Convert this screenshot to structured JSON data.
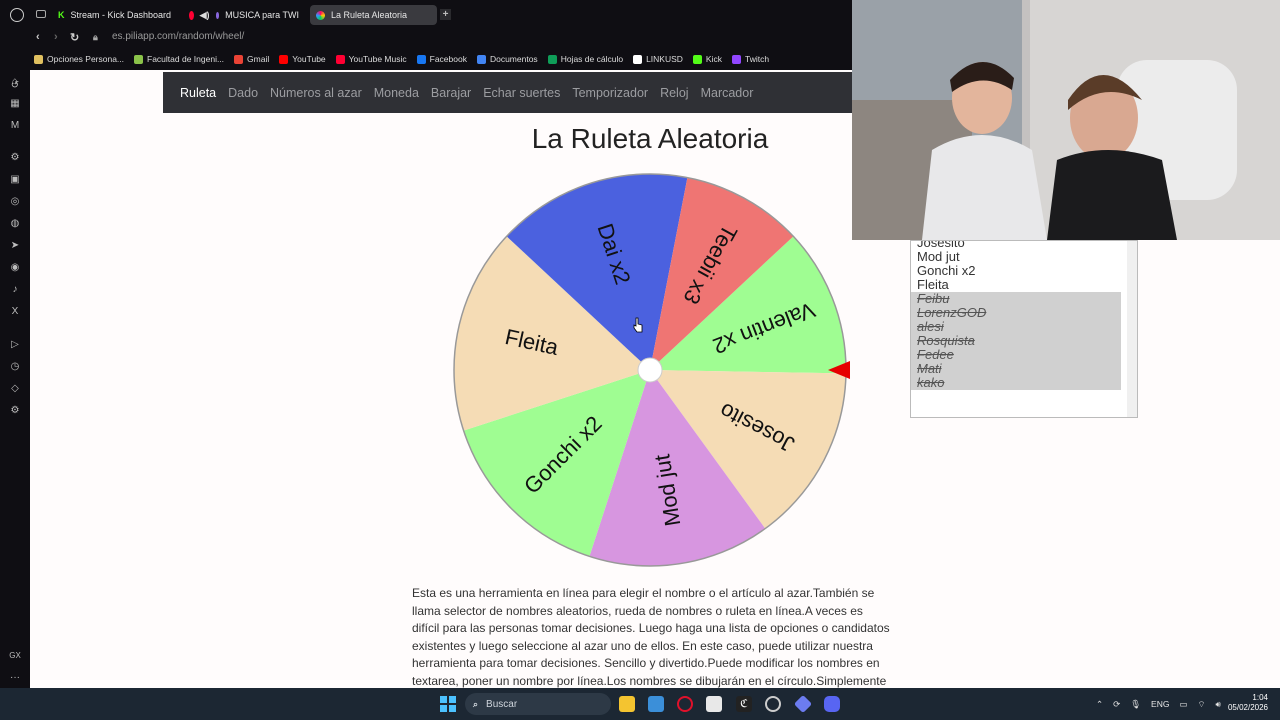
{
  "browser": {
    "tabs": [
      {
        "label": "Stream - Kick Dashboard",
        "icon": "kick-icon",
        "color": "#53fc18"
      },
      {
        "label": "MUSICA para TWI",
        "icon": "youtube-music-icon",
        "color": "#ff0033"
      },
      {
        "label": "La Ruleta Aleatoria",
        "icon": "piliapp-icon",
        "color": "#9c88ff"
      }
    ],
    "url": "es.piliapp.com/random/wheel/",
    "bookmarks": [
      {
        "label": "Opciones Persona...",
        "color": "#e0c060"
      },
      {
        "label": "Facultad de Ingeni...",
        "color": "#8bc34a"
      },
      {
        "label": "Gmail",
        "color": "#ea4335"
      },
      {
        "label": "YouTube",
        "color": "#ff0000"
      },
      {
        "label": "YouTube Music",
        "color": "#ff0033"
      },
      {
        "label": "Facebook",
        "color": "#1877f2"
      },
      {
        "label": "Documentos",
        "color": "#4285f4"
      },
      {
        "label": "Hojas de cálculo",
        "color": "#0f9d58"
      },
      {
        "label": "LINKUSD",
        "color": "#ffffff"
      },
      {
        "label": "Kick",
        "color": "#53fc18"
      },
      {
        "label": "Twitch",
        "color": "#9146ff"
      }
    ]
  },
  "nav": {
    "items": [
      "Ruleta",
      "Dado",
      "Números al azar",
      "Moneda",
      "Barajar",
      "Echar suertes",
      "Temporizador",
      "Reloj",
      "Marcador"
    ],
    "active": "Ruleta"
  },
  "page": {
    "title": "La Ruleta Aleatoria",
    "description": "Esta es una herramienta en línea para elegir el nombre o el artículo al azar.También se llama selector de nombres aleatorios, rueda de nombres o ruleta en línea.A veces es difícil para las personas tomar decisiones. Luego haga una lista de opciones o candidatos existentes y luego seleccione al azar uno de ellos. En este caso, puede utilizar nuestra herramienta para tomar decisiones. Sencillo y divertido.Puede modificar los nombres en textarea, poner un nombre por línea.Los nombres se dibujarán en el círculo.Simplemente haga clic en la rueda"
  },
  "wheel": {
    "segments": [
      {
        "label": "Valentin x2",
        "color": "#9ffd92"
      },
      {
        "label": "Josesito",
        "color": "#f5dcb5"
      },
      {
        "label": "Mod jut",
        "color": "#d796e0"
      },
      {
        "label": "Gonchi x2",
        "color": "#9ffd92"
      },
      {
        "label": "Fleita",
        "color": "#f5dcb5"
      },
      {
        "label": "Dai x2",
        "color": "#4b61df"
      },
      {
        "label": "Teebii x3",
        "color": "#ef7573"
      }
    ],
    "pointer_color": "#e60000"
  },
  "names_list": {
    "active": [
      "Josesito",
      "Mod jut",
      "Gonchi x2",
      "Fleita"
    ],
    "struck": [
      "Feibu",
      "LorenzGOD",
      "alesi",
      "Rosquista",
      "Fedee",
      "Mati",
      "kako"
    ]
  },
  "sidebar_icons": [
    "history-icon",
    "bag-icon",
    "calendar-icon",
    "m-icon",
    "chatgpt-icon",
    "twitch-icon",
    "messenger-icon",
    "whatsapp-icon",
    "telegram-icon",
    "instagram-icon",
    "tiktok-icon",
    "x-icon",
    "player-icon",
    "clock-icon",
    "cube-icon",
    "settings-icon"
  ],
  "sidebar_footer": {
    "gx": "GX",
    "more": "···"
  },
  "taskbar": {
    "search_placeholder": "Buscar",
    "lang": "ENG",
    "time": "1:04",
    "date": "05/02/2026"
  }
}
